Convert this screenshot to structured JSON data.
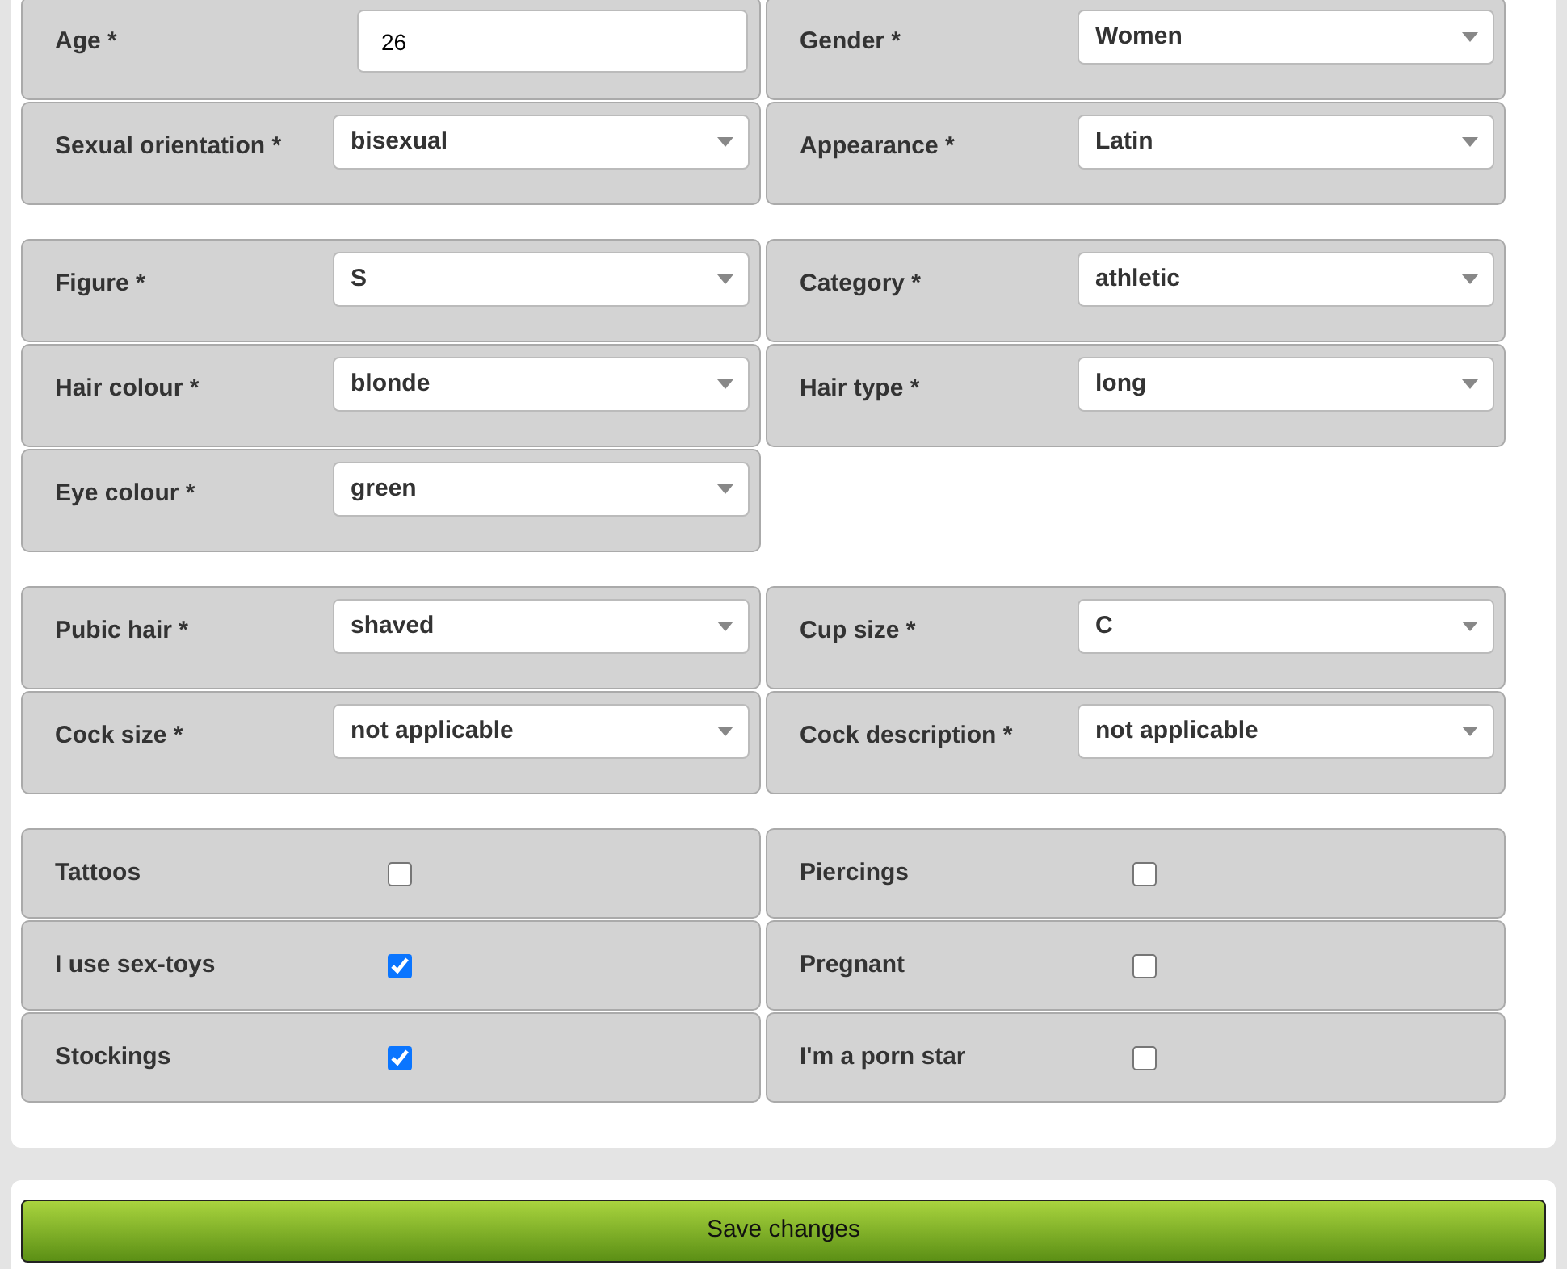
{
  "sections": [
    {
      "fields": [
        {
          "kind": "text",
          "label": "Age *",
          "value": "26"
        },
        {
          "kind": "select",
          "label": "Gender *",
          "value": "Women"
        },
        {
          "kind": "select",
          "label": "Sexual orientation *",
          "value": "bisexual"
        },
        {
          "kind": "select",
          "label": "Appearance *",
          "value": "Latin"
        }
      ]
    },
    {
      "fields": [
        {
          "kind": "select",
          "label": "Figure *",
          "value": "S"
        },
        {
          "kind": "select",
          "label": "Category *",
          "value": "athletic"
        },
        {
          "kind": "select",
          "label": "Hair colour *",
          "value": "blonde"
        },
        {
          "kind": "select",
          "label": "Hair type *",
          "value": "long"
        },
        {
          "kind": "select",
          "label": "Eye colour *",
          "value": "green"
        }
      ]
    },
    {
      "fields": [
        {
          "kind": "select",
          "label": "Pubic hair *",
          "value": "shaved"
        },
        {
          "kind": "select",
          "label": "Cup size *",
          "value": "C"
        },
        {
          "kind": "select",
          "label": "Cock size *",
          "value": "not applicable"
        },
        {
          "kind": "select",
          "label": "Cock description *",
          "value": "not applicable"
        }
      ]
    },
    {
      "fields": [
        {
          "kind": "checkbox",
          "label": "Tattoos",
          "checked": false
        },
        {
          "kind": "checkbox",
          "label": "Piercings",
          "checked": false
        },
        {
          "kind": "checkbox",
          "label": "I use sex-toys",
          "checked": true
        },
        {
          "kind": "checkbox",
          "label": "Pregnant",
          "checked": false
        },
        {
          "kind": "checkbox",
          "label": "Stockings",
          "checked": true
        },
        {
          "kind": "checkbox",
          "label": "I'm a porn star",
          "checked": false
        }
      ]
    }
  ],
  "save_button": "Save changes"
}
